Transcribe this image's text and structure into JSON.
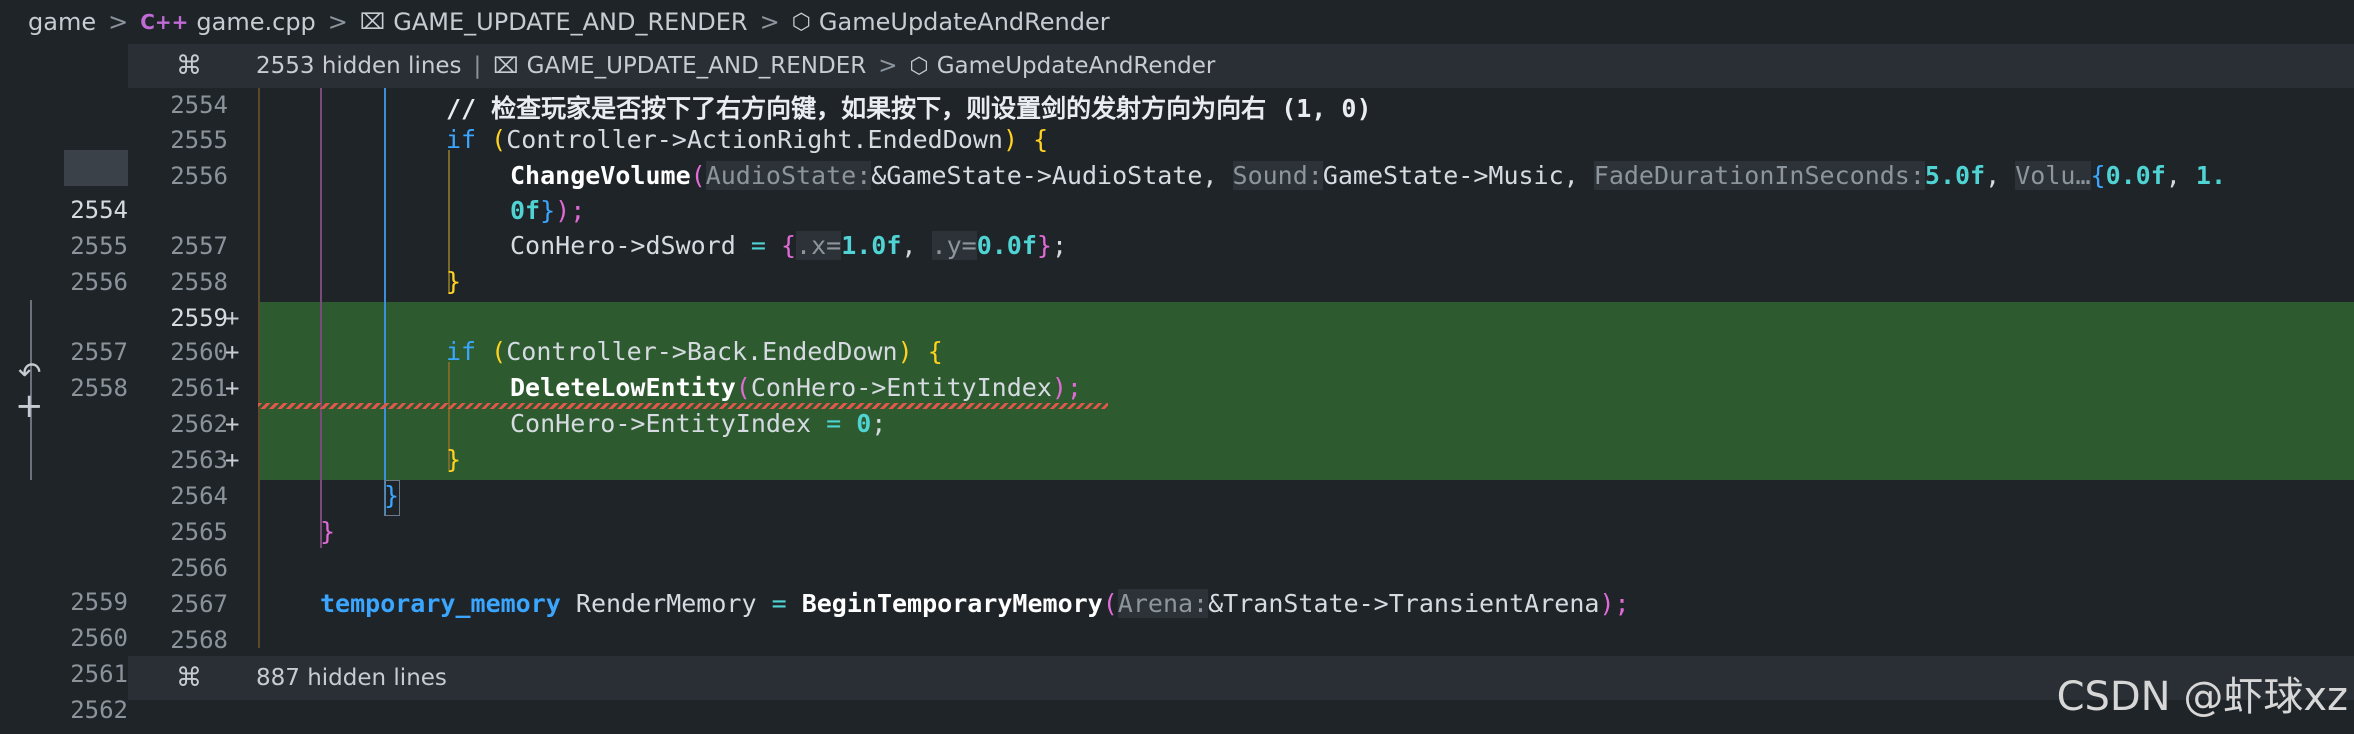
{
  "breadcrumb": {
    "items": [
      {
        "label": "game",
        "icon": null
      },
      {
        "label": "game.cpp",
        "icon": "cpp-icon",
        "icon_glyph": "C++"
      },
      {
        "label": "GAME_UPDATE_AND_RENDER",
        "icon": "namespace-icon",
        "icon_glyph": "⌧"
      },
      {
        "label": "GameUpdateAndRender",
        "icon": "cube-icon",
        "icon_glyph": "⬡"
      }
    ],
    "separator": ">"
  },
  "folds": {
    "top": {
      "hidden": "2553 hidden lines",
      "sep": "|",
      "scope1": "GAME_UPDATE_AND_RENDER",
      "scope2": "GameUpdateAndRender",
      "chev": ">",
      "icon_glyph": "⌘"
    },
    "bottom": {
      "hidden": "887 hidden lines",
      "icon_glyph": "⌘"
    }
  },
  "gutter": {
    "left_numbers": [
      "2554",
      "2555",
      "2556",
      "2557",
      "2558",
      "2559",
      "2560",
      "2561",
      "2562"
    ],
    "right_numbers": [
      "2554",
      "2555",
      "2556",
      "2557",
      "2558",
      "2559",
      "2560",
      "2561",
      "2562",
      "2563",
      "2564",
      "2565",
      "2566",
      "2567",
      "2568"
    ],
    "added_marker": "+",
    "revert_glyph": "↶",
    "add_glyph": "+"
  },
  "code": {
    "comment_2554": "// 检查玩家是否按下了右方向键，如果按下，则设置剑的发射方向为向右 (1, 0)",
    "if": "if",
    "paren_open": "(",
    "paren_close": ")",
    "brace_open": "{",
    "brace_close": "}",
    "cond_2555": "Controller->ActionRight.EndedDown",
    "fn_change": "ChangeVolume",
    "hint_audio": "AudioState:",
    "arg_audio": "&GameState->AudioState,",
    "hint_sound": "Sound:",
    "arg_sound": "GameState->Music,",
    "hint_fade": "FadeDurationInSeconds:",
    "arg_fade": "5.0f",
    "comma": ",",
    "hint_volu": "Volu…",
    "vec_open": "{",
    "vec_num1": "0.0f",
    "vec_num2": "1.",
    "wrap_num": "0f",
    "wrap_close": "}",
    "wrap_end": ");",
    "dsword_lhs": "ConHero->dSword",
    "eq": "=",
    "hint_x": ".x=",
    "num_x": "1.0f",
    "hint_y": ".y=",
    "num_y": "0.0f",
    "semi": ";",
    "cond_2560": "Controller->Back.EndedDown",
    "fn_delete": "DeleteLowEntity",
    "arg_delete": "ConHero->EntityIndex",
    "close_semi": ");",
    "idx_lhs": "ConHero->EntityIndex",
    "zero": "0",
    "type_tmp": "temporary_memory",
    "var_render": "RenderMemory",
    "fn_begin": "BeginTemporaryMemory",
    "hint_arena": "Arena:",
    "arg_arena": "&TranState->TransientArena"
  },
  "watermark": "CSDN @虾球xz",
  "colors": {
    "background": "#1f2429",
    "added_line": "#2e5a2f",
    "keyword": "#3aa6ff",
    "number": "#4fd3d3",
    "bracket_yellow": "#ffd21f",
    "bracket_pink": "#e06bd6",
    "error": "#e0574b"
  }
}
